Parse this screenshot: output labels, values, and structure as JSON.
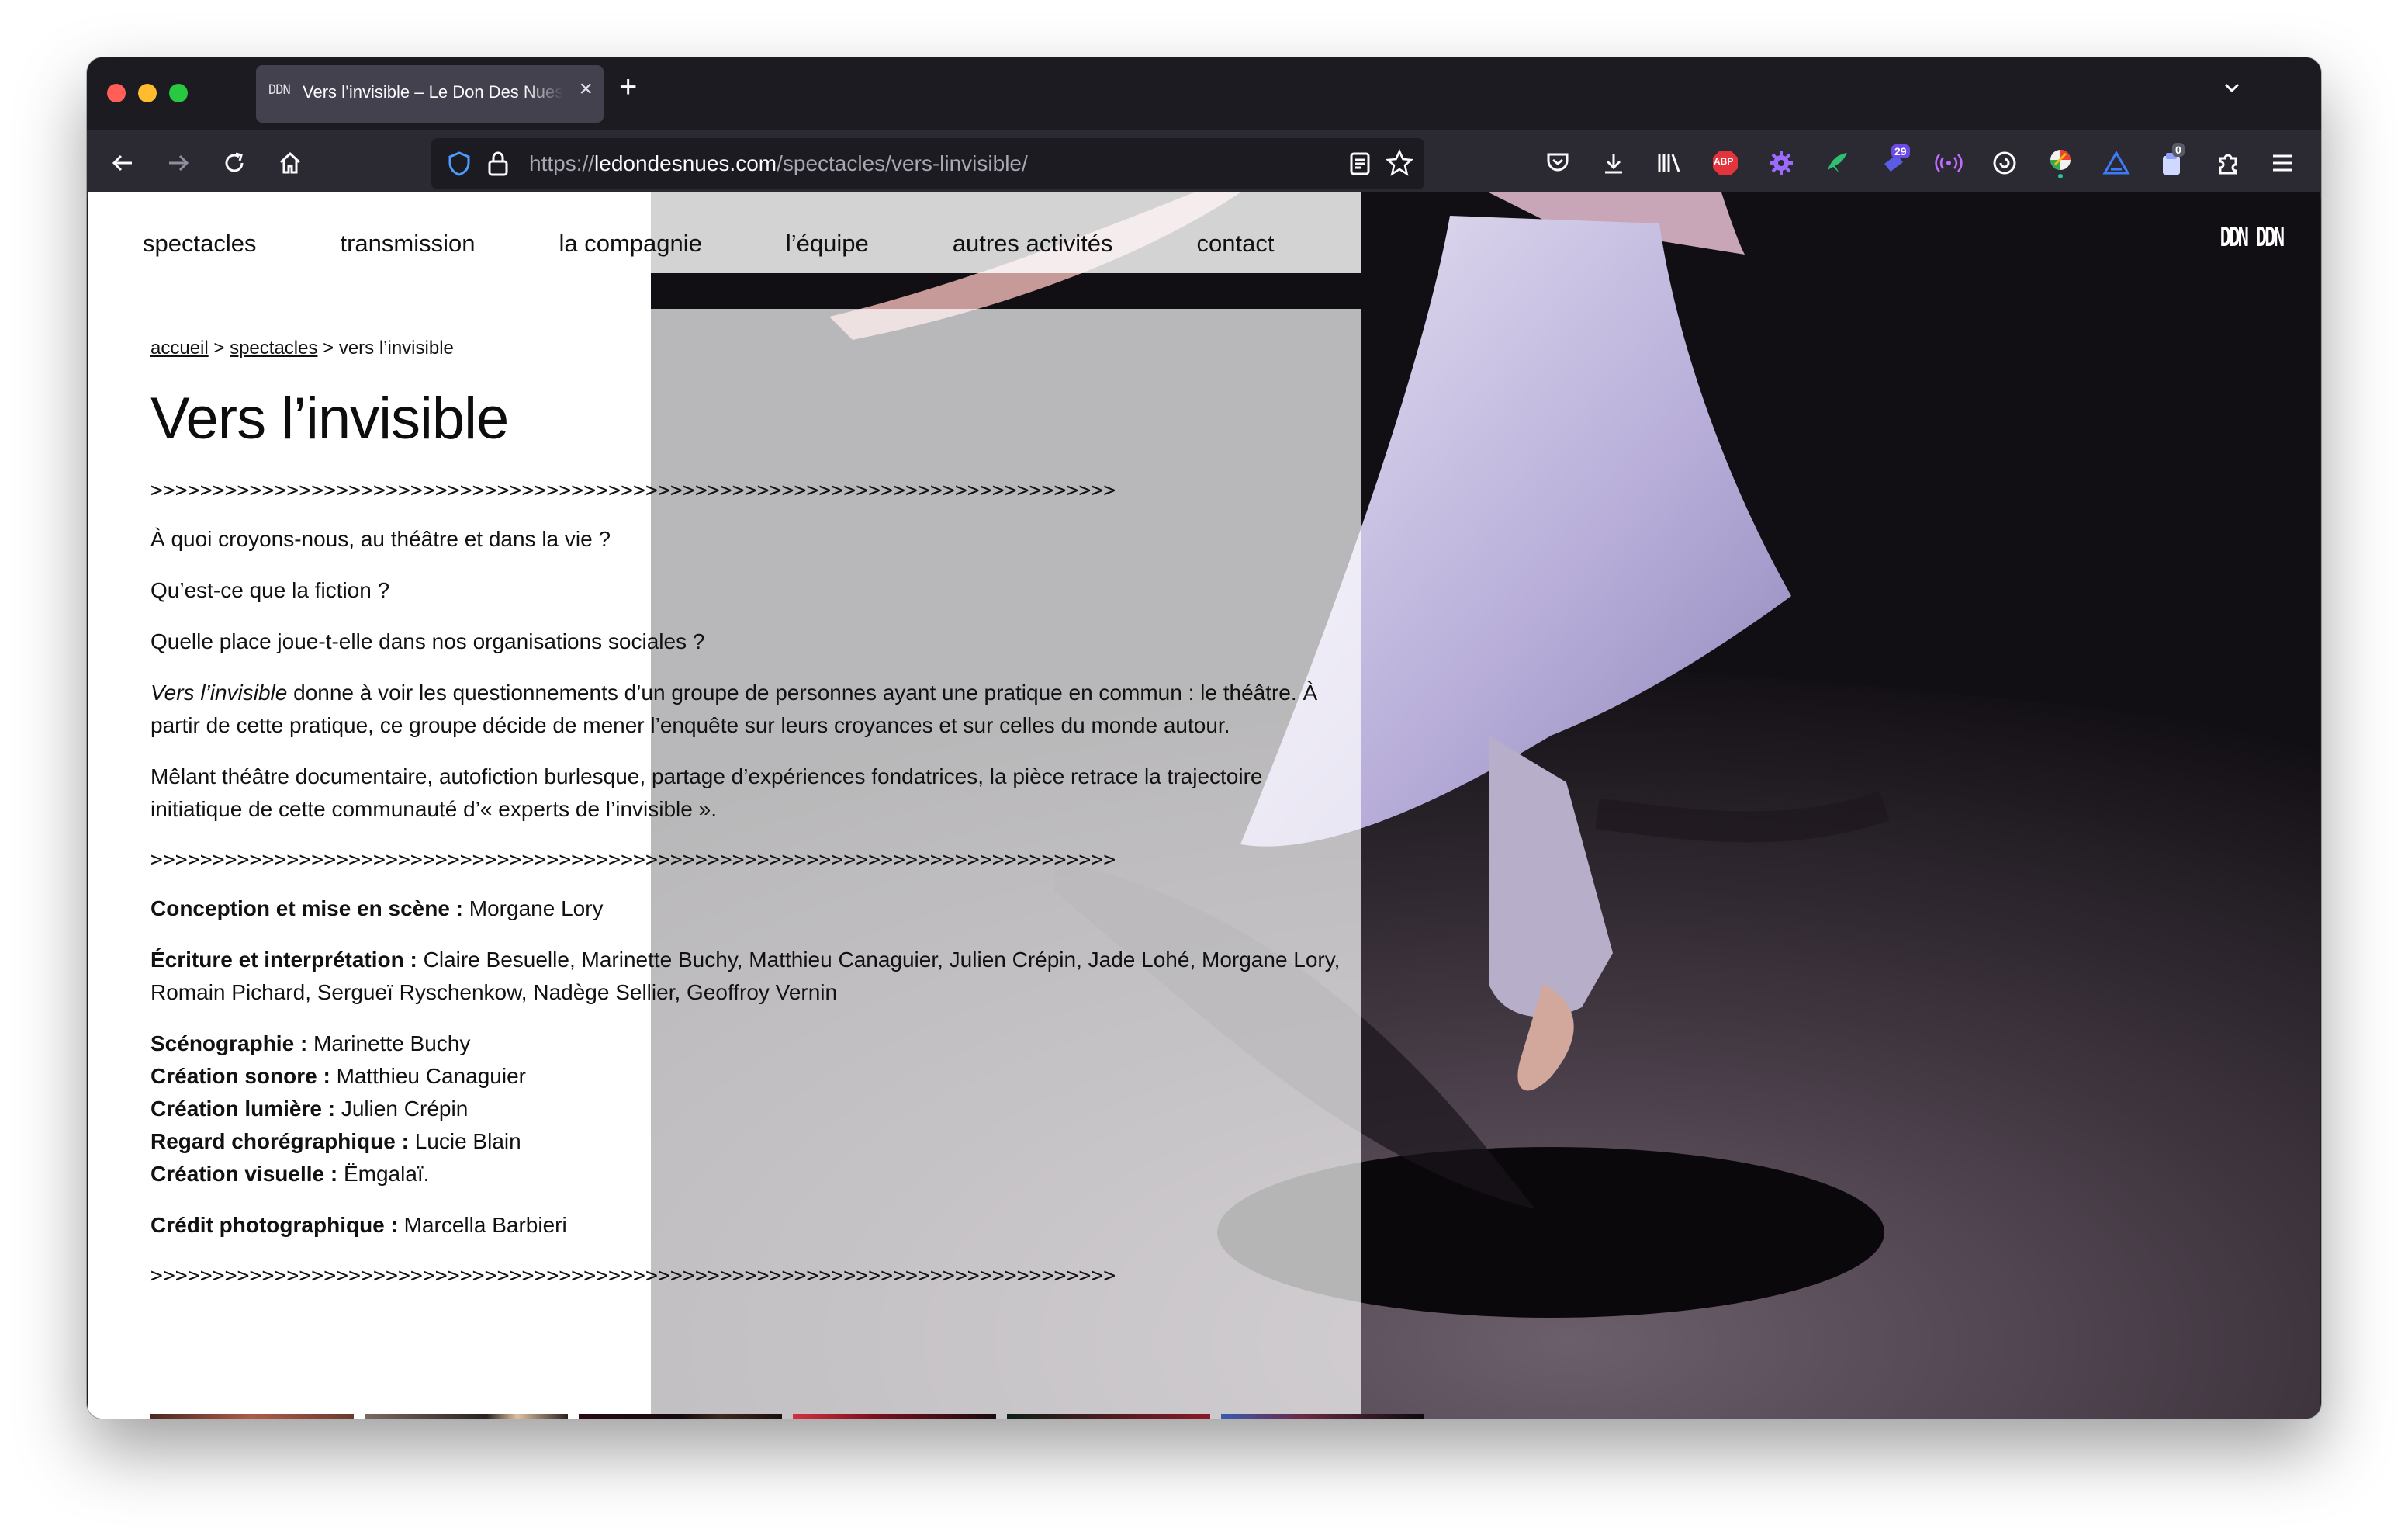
{
  "browser": {
    "tab_title": "Vers l’invisible – Le Don Des Nues",
    "tab_favicon": "DDN",
    "url_protocol": "https://",
    "url_domain": "ledondesnues.com",
    "url_path": "/spectacles/vers-linvisible/",
    "extension_badges": {
      "cal": "29",
      "notif": "0"
    },
    "extension_abp": "ABP"
  },
  "site": {
    "nav": [
      "spectacles",
      "transmission",
      "la compagnie",
      "l’équipe",
      "autres activités",
      "contact"
    ],
    "logo": "DDN DDN"
  },
  "breadcrumb": {
    "home": "accueil",
    "section": "spectacles",
    "sep": ">",
    "current": "vers l’invisible"
  },
  "title": "Vers l’invisible",
  "arrows": ">>>>>>>>>>>>>>>>>>>>>>>>>>>>>>>>>>>>>>>>>>>>>>>>>>>>>>>>>>>>>>>>>>>>>>>>>>>>>>",
  "intro": [
    "À quoi croyons-nous, au théâtre et dans la vie ?",
    "Qu’est-ce que la fiction ?",
    "Quelle place joue-t-elle dans nos organisations sociales ?"
  ],
  "description": {
    "italic": "Vers l’invisible",
    "rest": " donne à voir les questionnements d’un groupe de personnes ayant une pratique en commun : le théâtre. À partir de cette pratique, ce groupe décide de mener l’enquête sur leurs croyances et sur celles du monde autour."
  },
  "description2": "Mêlant théâtre documentaire, autofiction burlesque, partage d’expériences fondatrices, la pièce retrace la trajectoire initiatique de cette communauté d’« experts de l’invisible ».",
  "credits": {
    "conception": {
      "label": "Conception et mise en scène :",
      "value": " Morgane Lory"
    },
    "ecriture": {
      "label": "Écriture et interprétation :",
      "value": " Claire Besuelle, Marinette Buchy, Matthieu Canaguier, Julien Crépin, Jade Lohé, Morgane Lory, Romain Pichard, Sergueï Ryschenkow, Nadège Sellier, Geoffroy Vernin"
    },
    "technique": [
      {
        "label": "Scénographie :",
        "value": " Marinette Buchy"
      },
      {
        "label": "Création sonore :",
        "value": " Matthieu Canaguier"
      },
      {
        "label": "Création lumière :",
        "value": " Julien Crépin"
      },
      {
        "label": "Regard chorégraphique :",
        "value": " Lucie Blain"
      },
      {
        "label": "Création visuelle :",
        "value": " Ëmgalaï."
      }
    ],
    "photo": {
      "label": "Crédit photographique :",
      "value": " Marcella Barbieri"
    }
  },
  "colors": {
    "browser_bg": "#1c1b22",
    "toolbar": "#2b2a33",
    "accent": "#0060df"
  }
}
